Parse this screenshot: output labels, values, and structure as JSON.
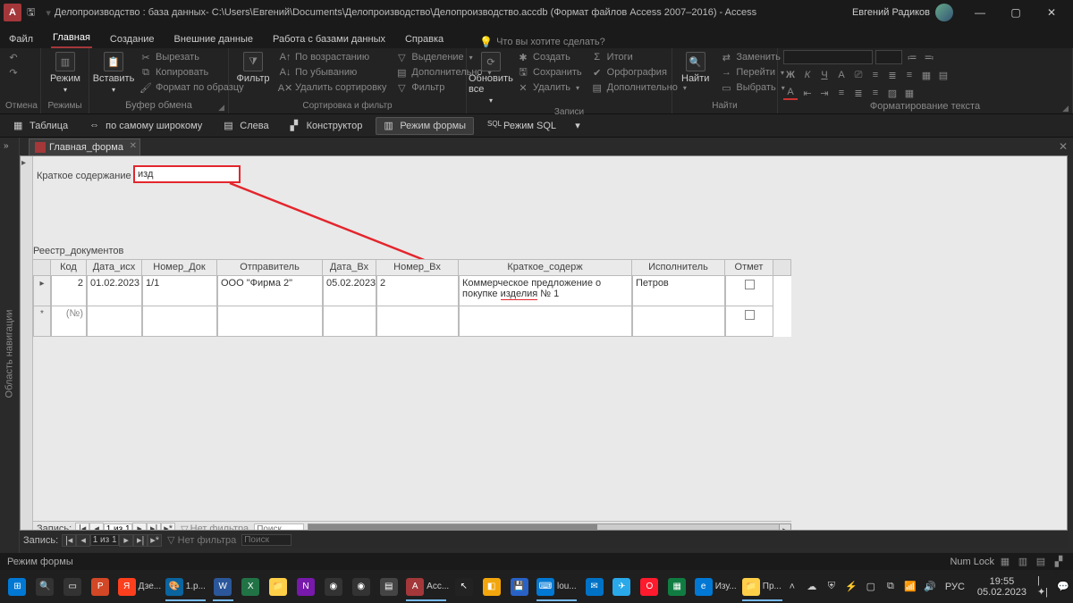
{
  "titlebar": {
    "app_letter": "A",
    "title": "Делопроизводство : база данных- C:\\Users\\Евгений\\Documents\\Делопроизводство\\Делопроизводство.accdb (Формат файлов Access 2007–2016)  -  Access",
    "user": "Евгений Радиков"
  },
  "tabs": {
    "file": "Файл",
    "home": "Главная",
    "create": "Создание",
    "external": "Внешние данные",
    "dbtools": "Работа с базами данных",
    "help": "Справка",
    "tellme": "Что вы хотите сделать?"
  },
  "ribbon": {
    "undo_group": "Отмена",
    "view_btn": "Режим",
    "views_group": "Режимы",
    "paste_btn": "Вставить",
    "cut": "Вырезать",
    "copy": "Копировать",
    "fmtpainter": "Формат по образцу",
    "clipboard_group": "Буфер обмена",
    "filter_btn": "Фильтр",
    "asc": "По возрастанию",
    "desc": "По убыванию",
    "clearsort": "Удалить сортировку",
    "selection": "Выделение",
    "advanced": "Дополнительно",
    "togglefilter": "Фильтр",
    "sortfilter_group": "Сортировка и фильтр",
    "refresh_btn": "Обновить все",
    "new": "Создать",
    "save": "Сохранить",
    "delete": "Удалить",
    "totals": "Итоги",
    "spelling": "Орфография",
    "more": "Дополнительно",
    "records_group": "Записи",
    "find_btn": "Найти",
    "replace": "Заменить",
    "goto": "Перейти",
    "select": "Выбрать",
    "find_group": "Найти",
    "textfmt_group": "Форматирование текста"
  },
  "viewrow": {
    "datasheet": "Таблица",
    "widest": "по самому широкому",
    "left": "Слева",
    "design": "Конструктор",
    "formview": "Режим формы",
    "sqlview": "Режим SQL",
    "sql_prefix": "SQL"
  },
  "nav_pane": "Область навигации",
  "nav_chevron": "»",
  "doc_tab": "Главная_форма",
  "form": {
    "label": "Краткое содержание",
    "value": "изд",
    "subform_title": "Реестр_документов"
  },
  "columns": {
    "kod": "Код",
    "data_ish": "Дата_исх",
    "nomer_dok": "Номер_Док",
    "otprav": "Отправитель",
    "data_vh": "Дата_Вх",
    "nomer_vh": "Номер_Вх",
    "kratkoe": "Краткое_содерж",
    "ispoln": "Исполнитель",
    "otmet": "Отмет"
  },
  "row1": {
    "kod": "2",
    "data_ish": "01.02.2023",
    "nomer_dok": "1/1",
    "otprav": "ООО \"Фирма 2\"",
    "data_vh": "05.02.2023",
    "nomer_vh": "2",
    "kratkoe_a": "Коммерческое предложение о покупке ",
    "kratkoe_u": "изделия",
    "kratkoe_b": " № 1",
    "ispoln": "Петров"
  },
  "newrow_kod": "(№)",
  "recnav": {
    "label": "Запись:",
    "first": "|◂",
    "prev": "◂",
    "pos": "1 из 1",
    "next": "▸",
    "last": "▸|",
    "newrec": "▸*",
    "nofilter": "Нет фильтра",
    "search": "Поиск"
  },
  "statusbar": {
    "mode": "Режим формы",
    "numlock": "Num Lock"
  },
  "taskbar": {
    "items": [
      {
        "name": "start",
        "bg": "#0078d4",
        "glyph": "⊞"
      },
      {
        "name": "search",
        "bg": "#333",
        "glyph": "🔍"
      },
      {
        "name": "taskview",
        "bg": "#333",
        "glyph": "▭"
      },
      {
        "name": "powerpoint",
        "bg": "#d24726",
        "glyph": "P"
      },
      {
        "name": "yandex",
        "bg": "#fc3f1d",
        "glyph": "Я",
        "label": "Дзе...",
        "wide": true
      },
      {
        "name": "paint",
        "bg": "#0a64a0",
        "glyph": "🎨",
        "label": "1.p...",
        "wide": true,
        "active": true
      },
      {
        "name": "word",
        "bg": "#2b579a",
        "glyph": "W",
        "active": true
      },
      {
        "name": "excel",
        "bg": "#217346",
        "glyph": "X"
      },
      {
        "name": "explorer",
        "bg": "#ffcf48",
        "glyph": "📁"
      },
      {
        "name": "onenote",
        "bg": "#7719aa",
        "glyph": "N"
      },
      {
        "name": "obs",
        "bg": "#333",
        "glyph": "◉"
      },
      {
        "name": "obs2",
        "bg": "#333",
        "glyph": "◉"
      },
      {
        "name": "files",
        "bg": "#444",
        "glyph": "▤"
      },
      {
        "name": "access",
        "bg": "#a4373a",
        "glyph": "A",
        "label": "Acc...",
        "wide": true,
        "active": true
      },
      {
        "name": "cursor",
        "bg": "#222",
        "glyph": "↖"
      },
      {
        "name": "chrome",
        "bg": "#f2a60d",
        "glyph": "◧"
      },
      {
        "name": "save",
        "bg": "#2962c7",
        "glyph": "💾"
      },
      {
        "name": "vscode",
        "bg": "#0078d4",
        "glyph": "⌨",
        "label": "lou...",
        "wide": true,
        "active": true
      },
      {
        "name": "mail",
        "bg": "#0072c6",
        "glyph": "✉"
      },
      {
        "name": "telegram",
        "bg": "#29a9ea",
        "glyph": "✈"
      },
      {
        "name": "opera",
        "bg": "#ff1b2d",
        "glyph": "O"
      },
      {
        "name": "planner",
        "bg": "#107c41",
        "glyph": "▦"
      },
      {
        "name": "edge",
        "bg": "#0078d4",
        "glyph": "e",
        "label": "Изу...",
        "wide": true
      },
      {
        "name": "explorer2",
        "bg": "#ffcf48",
        "glyph": "📁",
        "label": "Пр...",
        "wide": true,
        "active": true
      }
    ],
    "tray": {
      "chevron": "˄",
      "onedrive": "☁",
      "shield": "⛨",
      "power": "⚡",
      "gpu": "▢",
      "net": "⧉",
      "wifi": "📶",
      "vol": "🔊",
      "lang": "РУС",
      "time": "19:55",
      "date": "05.02.2023"
    }
  }
}
